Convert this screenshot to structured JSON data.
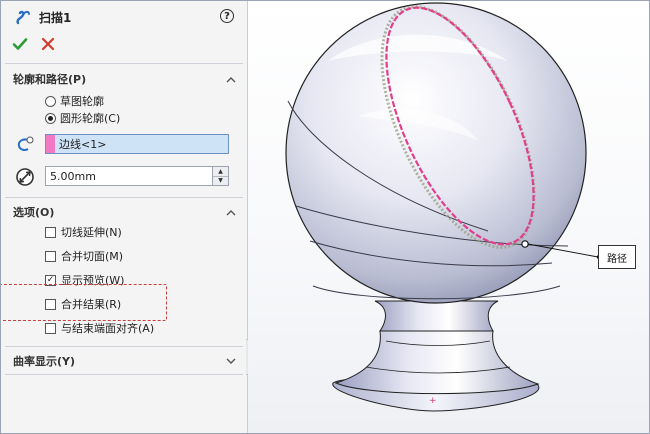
{
  "feature": {
    "title": "扫描1",
    "help_icon": "help-circle-icon",
    "ok_icon": "check-icon",
    "cancel_icon": "close-x-icon"
  },
  "profile_path": {
    "header": "轮廓和路径(P)",
    "options": [
      {
        "label": "草图轮廓",
        "selected": false
      },
      {
        "label": "圆形轮廓(C)",
        "selected": true
      }
    ],
    "path_selection": "边线<1>",
    "path_swatch_color": "#f27ac5",
    "diameter_value": "5.00mm"
  },
  "options": {
    "header": "选项(O)",
    "items": [
      {
        "label": "切线延伸(N)",
        "checked": false
      },
      {
        "label": "合并切面(M)",
        "checked": false
      },
      {
        "label": "显示预览(W)",
        "checked": true
      },
      {
        "label": "合并结果(R)",
        "checked": false
      },
      {
        "label": "与结束端面对齐(A)",
        "checked": false
      }
    ]
  },
  "curvature": {
    "header": "曲率显示(Y)"
  },
  "viewport": {
    "callout_label": "路径",
    "path_color": "#e23e8a"
  },
  "colors": {
    "accent_check": "#2e9b3a",
    "cancel_red": "#d23a2f",
    "highlight_border": "#c84040"
  }
}
